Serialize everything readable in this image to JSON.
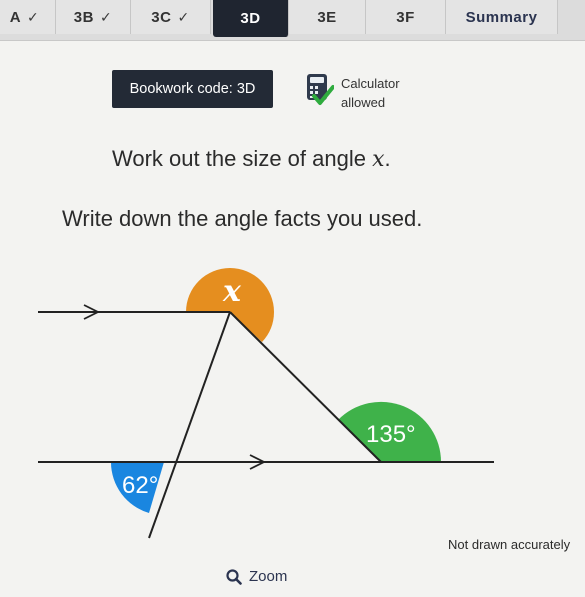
{
  "tabs": [
    {
      "label": "A",
      "checked": true
    },
    {
      "label": "3B",
      "checked": true
    },
    {
      "label": "3C",
      "checked": true
    },
    {
      "label": "3D",
      "checked": false,
      "active": true
    },
    {
      "label": "3E",
      "checked": false
    },
    {
      "label": "3F",
      "checked": false
    },
    {
      "label": "Summary",
      "checked": false
    }
  ],
  "bookwork": {
    "label": "Bookwork code: 3D"
  },
  "calculator": {
    "line1": "Calculator",
    "line2": "allowed",
    "icon": "calculator-allowed-icon"
  },
  "question": {
    "prefix": "Work out the size of angle ",
    "variable": "x",
    "suffix": "."
  },
  "instruction": "Write down the angle facts you used.",
  "diagram": {
    "angle_x_label": "x",
    "angle_135_label": "135°",
    "angle_62_label": "62°",
    "colors": {
      "x": "#e58e1f",
      "a135": "#3fb24a",
      "a62": "#1a86e0",
      "line": "#222222"
    }
  },
  "footnote": "Not drawn accurately",
  "zoom": {
    "label": "Zoom",
    "icon": "magnifier-icon"
  },
  "colors": {
    "active_tab": "#1f2530",
    "bookwork_bg": "#232a36",
    "check_green": "#2eab3e"
  }
}
